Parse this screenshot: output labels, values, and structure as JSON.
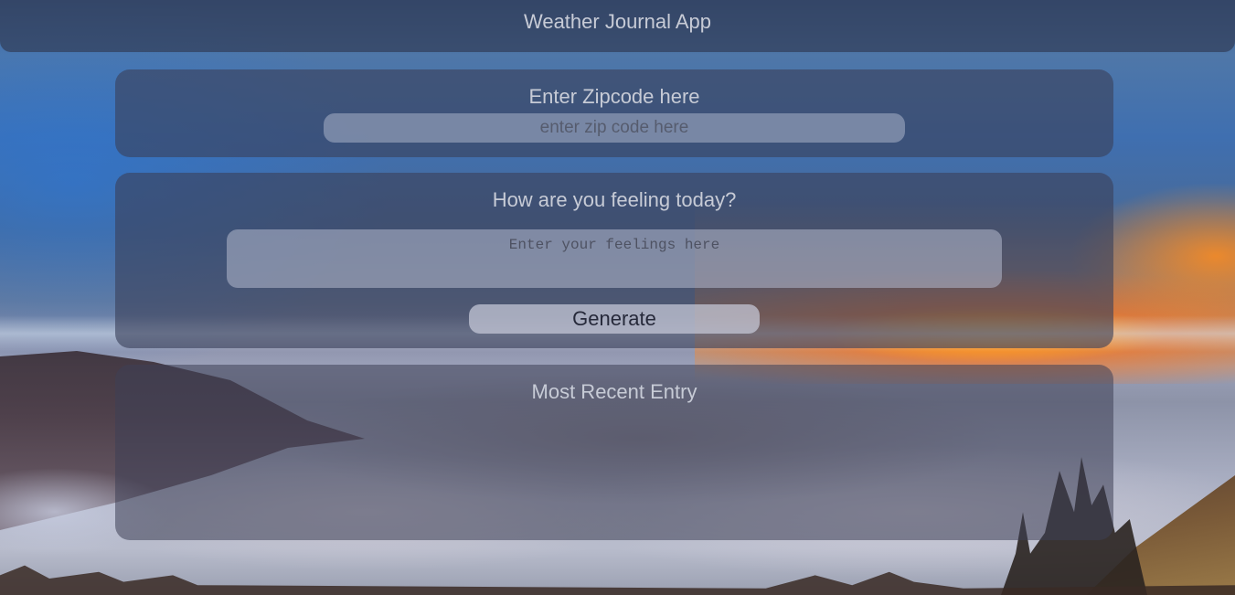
{
  "header": {
    "title": "Weather Journal App"
  },
  "zip_section": {
    "label": "Enter Zipcode here",
    "input_value": "",
    "input_placeholder": "enter zip code here"
  },
  "feelings_section": {
    "label": "How are you feeling today?",
    "input_value": "",
    "input_placeholder": "Enter your feelings here",
    "generate_label": "Generate"
  },
  "entry_section": {
    "label": "Most Recent Entry"
  },
  "colors": {
    "panel": "#3a405a",
    "text": "#c7cbd6",
    "button": "#c8cbda",
    "button_text": "#26293a"
  }
}
